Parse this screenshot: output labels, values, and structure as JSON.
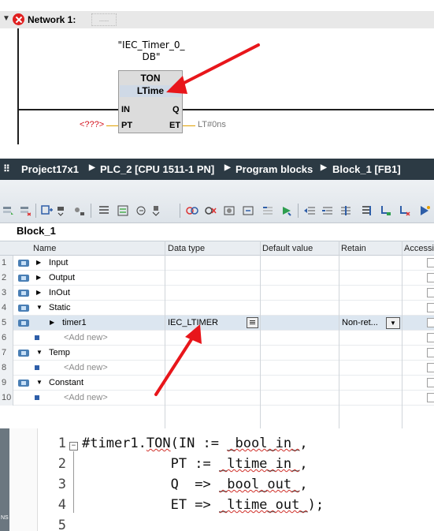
{
  "network": {
    "title": "Network 1:",
    "comment_placeholder": "....."
  },
  "fb_block": {
    "instance_name_line1": "\"IEC_Timer_0_",
    "instance_name_line2": "DB\"",
    "type": "TON",
    "time_type": "LTime",
    "pins": {
      "in": "IN",
      "pt": "PT",
      "q": "Q",
      "et": "ET"
    },
    "pt_value": "<???>",
    "et_value": "LT#0ns"
  },
  "breadcrumb": {
    "items": [
      "Project17x1",
      "PLC_2 [CPU 1511-1 PN]",
      "Program blocks",
      "Block_1 [FB1]"
    ],
    "separator": "▶"
  },
  "toolbar": {
    "icons": [
      "insert-row-icon",
      "delete-row-icon",
      "monitor-icon",
      "expand-icon",
      "list-icon",
      "download-icon",
      "settings-icon",
      "call-icon",
      "jump-icon",
      "rung-icon",
      "box-icon",
      "network-icon",
      "check-icon",
      "go-left-icon",
      "indent-icon",
      "outdent-icon",
      "split-icon",
      "sort-icon",
      "filter-icon",
      "bookmark-icon"
    ]
  },
  "block_table": {
    "title": "Block_1",
    "columns": [
      "Name",
      "Data type",
      "Default value",
      "Retain",
      "Accessi"
    ],
    "rows": [
      {
        "num": "1",
        "name": "Input",
        "expander": "▶",
        "level": 0,
        "icon": "interface-icon",
        "data_type": "",
        "retain": ""
      },
      {
        "num": "2",
        "name": "Output",
        "expander": "▶",
        "level": 0,
        "icon": "interface-icon",
        "data_type": "",
        "retain": ""
      },
      {
        "num": "3",
        "name": "InOut",
        "expander": "▶",
        "level": 0,
        "icon": "interface-icon",
        "data_type": "",
        "retain": ""
      },
      {
        "num": "4",
        "name": "Static",
        "expander": "▼",
        "level": 0,
        "icon": "interface-icon",
        "data_type": "",
        "retain": ""
      },
      {
        "num": "5",
        "name": "timer1",
        "expander": "▶",
        "level": 1,
        "icon": "interface-icon",
        "data_type": "IEC_LTIMER",
        "retain": "Non-ret...",
        "selected": true
      },
      {
        "num": "6",
        "name": "<Add new>",
        "expander": "",
        "level": 1,
        "icon": "none",
        "data_type": "",
        "retain": ""
      },
      {
        "num": "7",
        "name": "Temp",
        "expander": "▼",
        "level": 0,
        "icon": "interface-icon",
        "data_type": "",
        "retain": ""
      },
      {
        "num": "8",
        "name": "<Add new>",
        "expander": "",
        "level": 1,
        "icon": "none",
        "data_type": "",
        "retain": ""
      },
      {
        "num": "9",
        "name": "Constant",
        "expander": "▼",
        "level": 0,
        "icon": "interface-icon",
        "data_type": "",
        "retain": ""
      },
      {
        "num": "10",
        "name": "<Add new>",
        "expander": "",
        "level": 1,
        "icon": "none",
        "data_type": "",
        "retain": ""
      }
    ]
  },
  "code": {
    "side_label": "NS",
    "lines": [
      {
        "num": "1",
        "text": "#timer1.TON(IN := ",
        "arg": "_bool_in_",
        "tail": ","
      },
      {
        "num": "2",
        "text": "           PT := ",
        "arg": "_ltime_in_",
        "tail": ","
      },
      {
        "num": "3",
        "text": "           Q  => ",
        "arg": "_bool_out_",
        "tail": ","
      },
      {
        "num": "4",
        "text": "           ET => ",
        "arg": "_ltime_out_",
        "tail": ");"
      },
      {
        "num": "5",
        "text": "",
        "arg": "",
        "tail": ""
      }
    ],
    "call_word": "TON"
  },
  "colors": {
    "breadcrumb_bg": "#2c3a44",
    "error_red": "#e02020",
    "annotation_arrow": "#e8161b",
    "pt_value": "#d4141f",
    "selected_row": "#dce6f0"
  }
}
